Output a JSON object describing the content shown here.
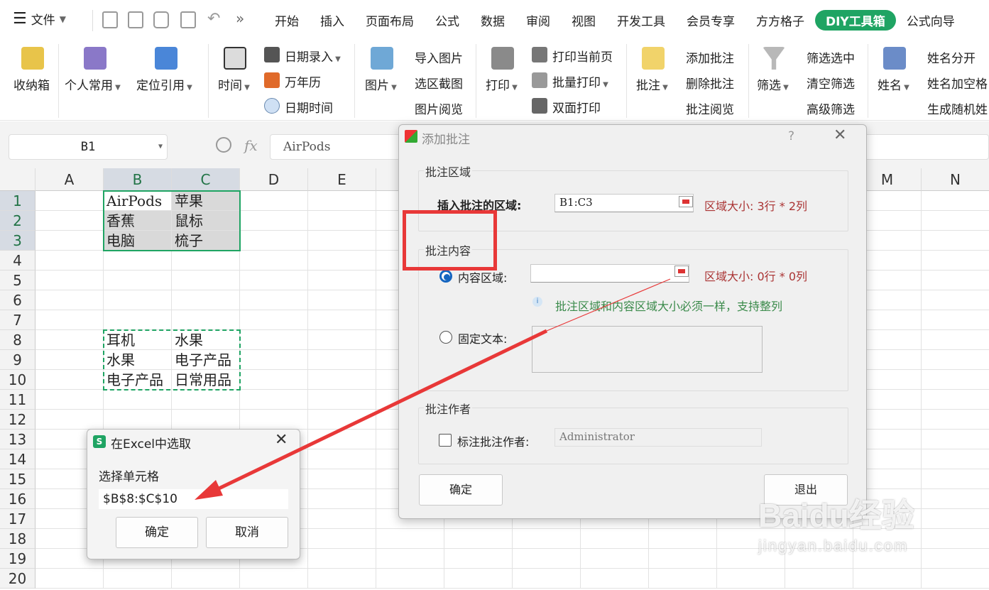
{
  "menubar": {
    "file_label": "文件",
    "more_label": "»",
    "tabs": [
      "开始",
      "插入",
      "页面布局",
      "公式",
      "数据",
      "审阅",
      "视图",
      "开发工具",
      "会员专享",
      "方方格子",
      "DIY工具箱",
      "公式向导"
    ],
    "active_tab": "DIY工具箱"
  },
  "ribbon": {
    "shounaxiang": "收纳箱",
    "gerenchangyong": "个人常用",
    "dingweiyinyong": "定位引用",
    "shijian": "时间",
    "riqiluru": "日期录入",
    "wannianli": "万年历",
    "riqishijian": "日期时间",
    "tupian": "图片",
    "daorutupian": "导入图片",
    "xuanqujietu": "选区截图",
    "tupianyuelan": "图片阅览",
    "dayin": "打印",
    "dayindangqianye": "打印当前页",
    "piliangdayin": "批量打印",
    "shuangmiandayin": "双面打印",
    "pizhu": "批注",
    "tianjiapizhu": "添加批注",
    "shanchupizhu": "删除批注",
    "pizhuyuelan": "批注阅览",
    "shaixuan": "筛选",
    "shaixuanxuanzhong": "筛选选中",
    "qingkongshaixuan": "清空筛选",
    "gaojishaixuan": "高级筛选",
    "xingming": "姓名",
    "xingmingfenkai": "姓名分开",
    "xingmingjiakongge": "姓名加空格",
    "shengchengsuiji": "生成随机姓"
  },
  "formula_bar": {
    "name_box": "B1",
    "fx": "fx",
    "value": "AirPods"
  },
  "grid": {
    "columns": [
      "A",
      "B",
      "C",
      "D",
      "E",
      "M",
      "N"
    ],
    "rows": [
      "1",
      "2",
      "3",
      "4",
      "5",
      "6",
      "7",
      "8",
      "9",
      "10",
      "11",
      "12",
      "13",
      "14",
      "15",
      "16",
      "17",
      "18",
      "19",
      "20"
    ],
    "cells": {
      "B1": "AirPods",
      "C1": "苹果",
      "B2": "香蕉",
      "C2": "鼠标",
      "B3": "电脑",
      "C3": "梳子",
      "B8": "耳机",
      "C8": "水果",
      "B9": "水果",
      "C9": "电子产品",
      "B10": "电子产品",
      "C10": "日常用品"
    }
  },
  "dialog": {
    "title": "添加批注",
    "help": "?",
    "close": "✕",
    "group_area": "批注区域",
    "insert_label": "插入批注的区域:",
    "insert_value": "B1:C3",
    "insert_size": "区域大小:  3行 * 2列",
    "group_content": "批注内容",
    "content_area_label": "内容区域:",
    "content_area_value": "",
    "content_size": "区域大小:  0行 * 0列",
    "tip": "批注区域和内容区域大小必须一样，支持整列",
    "fixed_text_label": "固定文本:",
    "group_author": "批注作者",
    "author_check_label": "标注批注作者:",
    "author_value": "Administrator",
    "ok": "确定",
    "exit": "退出"
  },
  "picker_dialog": {
    "title": "在Excel中选取",
    "icon_letter": "S",
    "close": "✕",
    "prompt": "选择单元格",
    "value": "$B$8:$C$10",
    "ok": "确定",
    "cancel": "取消"
  },
  "watermark": {
    "brand": "Baidu经验",
    "url": "jingyan.baidu.com"
  },
  "colors": {
    "accent_green": "#1fa463",
    "annotation_red": "#e83838"
  }
}
